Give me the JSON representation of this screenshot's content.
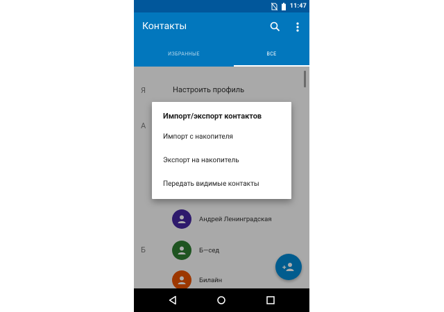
{
  "status_bar": {
    "time": "11:47"
  },
  "app_bar": {
    "title": "Контакты",
    "tabs": [
      {
        "label": "ИЗБРАННЫЕ"
      },
      {
        "label": "ВСЕ"
      }
    ]
  },
  "list": {
    "section_letters": [
      "Я",
      "А",
      "Б"
    ],
    "profile_label": "Настроить профиль",
    "contacts": [
      {
        "name": "Андрей Ленинградская",
        "avatar_color": "#4527a0"
      },
      {
        "name": "Б—сед",
        "avatar_color": "#2e7d32"
      },
      {
        "name": "Билайн",
        "avatar_color": "#e65100"
      }
    ]
  },
  "dialog": {
    "title": "Импорт/экспорт контактов",
    "items": [
      {
        "label": "Импорт с накопителя"
      },
      {
        "label": "Экспорт на накопитель"
      },
      {
        "label": "Передать видимые контакты"
      }
    ]
  },
  "colors": {
    "primary": "#0277bd",
    "primary_dark": "#01579b",
    "accent": "#0288d1"
  },
  "icons": {
    "status": [
      "no-sim-icon",
      "battery-icon"
    ],
    "app_bar": [
      "search-icon",
      "more-vert-icon"
    ],
    "fab": "add-contact-icon",
    "nav": [
      "back-icon",
      "home-icon",
      "recents-icon"
    ]
  }
}
